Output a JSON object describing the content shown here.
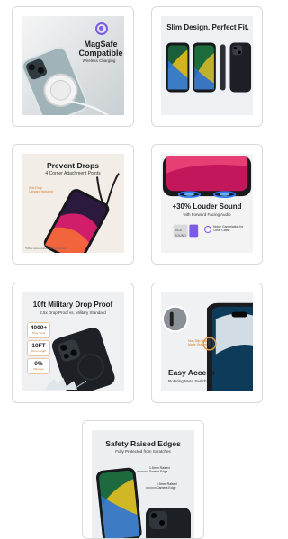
{
  "cards": [
    {
      "title": "MagSafe",
      "title2": "Compatible",
      "subtitle": "Wireless Charging"
    },
    {
      "title": "Slim Design. Perfect Fit."
    },
    {
      "title": "Prevent Drops",
      "subtitle": "4 Corner Attachment Points",
      "callout": "Anti-Drop Lanyard Included",
      "footnote": "*Other accessories sold separately"
    },
    {
      "title": "+30% Louder Sound",
      "subtitle": "with Forward Facing Audio",
      "badge": "Noise Cancelation for Clear Calls",
      "rows": [
        "MCA",
        "SOUND"
      ]
    },
    {
      "title": "10ft Military Drop Proof",
      "subtitle": "2.5x Drop Proof vs. Military Standard",
      "stats": [
        {
          "value": "4000+",
          "label": "Drop Tests"
        },
        {
          "value": "10FT",
          "label": "Drop Height"
        },
        {
          "value": "0%",
          "label": "Damage"
        }
      ]
    },
    {
      "title": "Easy Access",
      "subtitle": "Rotating Mute Switch",
      "callout": "Non-Slip Grip Matte Texture"
    },
    {
      "title": "Safety Raised Edges",
      "subtitle": "Fully Protected from Scratches",
      "callout1": "1.5mm Raised Screen Edge",
      "callout2": "1.5mm Raised Camera Edge"
    }
  ],
  "colors": {
    "accent_purple": "#7b5ce6",
    "accent_orange": "#e39a3a",
    "card_border": "#d9d9d9",
    "phone_black": "#15171b"
  }
}
